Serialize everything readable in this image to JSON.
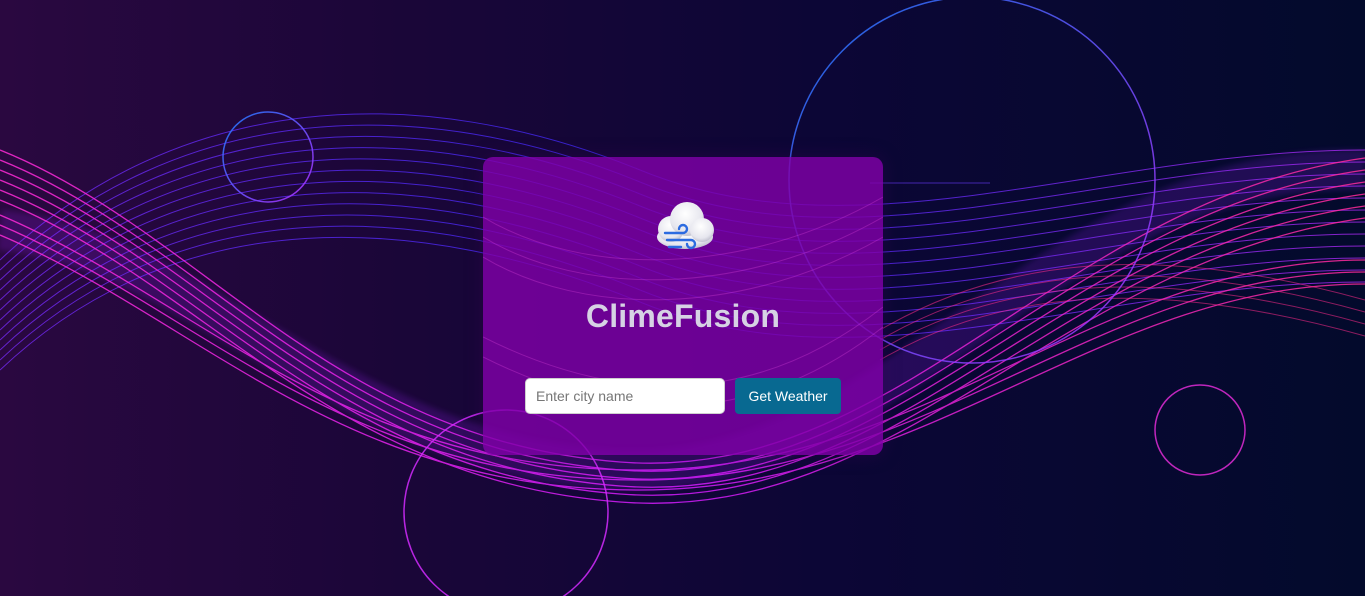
{
  "app": {
    "title": "ClimeFusion",
    "logo_icon": "cloud-wind-icon"
  },
  "search": {
    "placeholder": "Enter city name",
    "value": ""
  },
  "actions": {
    "get_weather_label": "Get Weather"
  },
  "theme": {
    "card_color": "#8000a8",
    "button_color": "#086991",
    "title_color": "#d6d2e4",
    "wave_magenta": "#ff2bd6",
    "wave_blue": "#4b2bff"
  }
}
